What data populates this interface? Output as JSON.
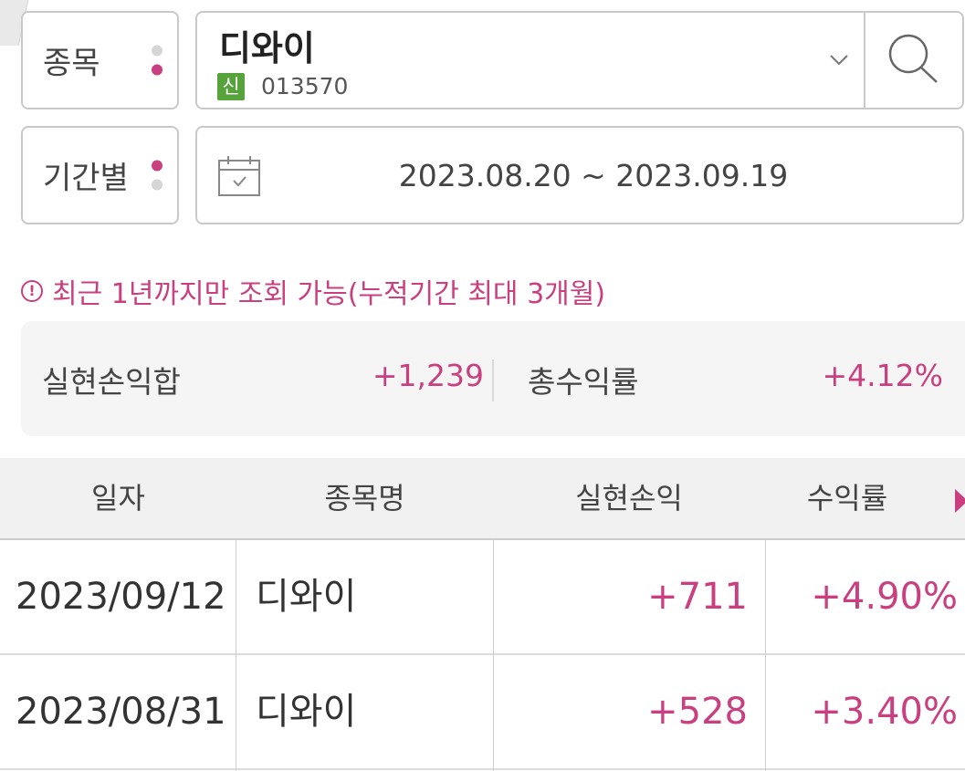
{
  "filters": {
    "stock_label": "종목",
    "period_label": "기간별",
    "stock": {
      "name": "디와이",
      "badge": "신",
      "code": "013570"
    },
    "date_range": "2023.08.20 ~ 2023.09.19",
    "icons": [
      "chevron-down-icon",
      "search-icon",
      "calendar-icon"
    ]
  },
  "notice": "최근 1년까지만 조회 가능(누적기간 최대 3개월)",
  "summary": {
    "realized_pl_label": "실현손익합",
    "realized_pl_value": "+1,239",
    "total_return_label": "총수익률",
    "total_return_value": "+4.12%"
  },
  "table": {
    "headers": [
      "일자",
      "종목명",
      "실현손익",
      "수익률"
    ],
    "rows": [
      {
        "date": "2023/09/12",
        "name": "디와이",
        "pl": "+711",
        "rate": "+4.90%"
      },
      {
        "date": "2023/08/31",
        "name": "디와이",
        "pl": "+528",
        "rate": "+3.40%"
      }
    ]
  },
  "colors": {
    "accent": "#c93f7f",
    "badge": "#56a33c",
    "border": "#c9c9c9"
  }
}
